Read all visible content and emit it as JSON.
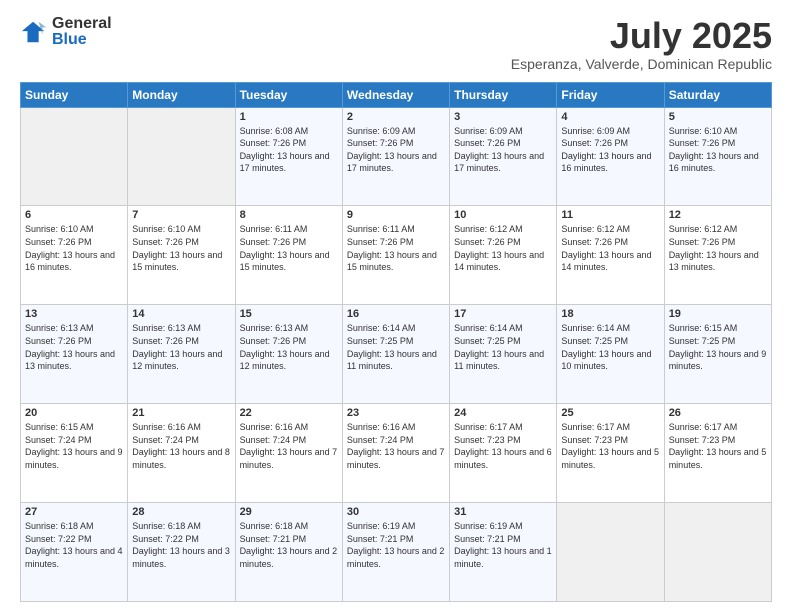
{
  "logo": {
    "general": "General",
    "blue": "Blue"
  },
  "title": "July 2025",
  "subtitle": "Esperanza, Valverde, Dominican Republic",
  "days_of_week": [
    "Sunday",
    "Monday",
    "Tuesday",
    "Wednesday",
    "Thursday",
    "Friday",
    "Saturday"
  ],
  "weeks": [
    [
      {
        "day": "",
        "empty": true
      },
      {
        "day": "",
        "empty": true
      },
      {
        "day": "1",
        "sunrise": "6:08 AM",
        "sunset": "7:26 PM",
        "daylight": "13 hours and 17 minutes."
      },
      {
        "day": "2",
        "sunrise": "6:09 AM",
        "sunset": "7:26 PM",
        "daylight": "13 hours and 17 minutes."
      },
      {
        "day": "3",
        "sunrise": "6:09 AM",
        "sunset": "7:26 PM",
        "daylight": "13 hours and 17 minutes."
      },
      {
        "day": "4",
        "sunrise": "6:09 AM",
        "sunset": "7:26 PM",
        "daylight": "13 hours and 16 minutes."
      },
      {
        "day": "5",
        "sunrise": "6:10 AM",
        "sunset": "7:26 PM",
        "daylight": "13 hours and 16 minutes."
      }
    ],
    [
      {
        "day": "6",
        "sunrise": "6:10 AM",
        "sunset": "7:26 PM",
        "daylight": "13 hours and 16 minutes."
      },
      {
        "day": "7",
        "sunrise": "6:10 AM",
        "sunset": "7:26 PM",
        "daylight": "13 hours and 15 minutes."
      },
      {
        "day": "8",
        "sunrise": "6:11 AM",
        "sunset": "7:26 PM",
        "daylight": "13 hours and 15 minutes."
      },
      {
        "day": "9",
        "sunrise": "6:11 AM",
        "sunset": "7:26 PM",
        "daylight": "13 hours and 15 minutes."
      },
      {
        "day": "10",
        "sunrise": "6:12 AM",
        "sunset": "7:26 PM",
        "daylight": "13 hours and 14 minutes."
      },
      {
        "day": "11",
        "sunrise": "6:12 AM",
        "sunset": "7:26 PM",
        "daylight": "13 hours and 14 minutes."
      },
      {
        "day": "12",
        "sunrise": "6:12 AM",
        "sunset": "7:26 PM",
        "daylight": "13 hours and 13 minutes."
      }
    ],
    [
      {
        "day": "13",
        "sunrise": "6:13 AM",
        "sunset": "7:26 PM",
        "daylight": "13 hours and 13 minutes."
      },
      {
        "day": "14",
        "sunrise": "6:13 AM",
        "sunset": "7:26 PM",
        "daylight": "13 hours and 12 minutes."
      },
      {
        "day": "15",
        "sunrise": "6:13 AM",
        "sunset": "7:26 PM",
        "daylight": "13 hours and 12 minutes."
      },
      {
        "day": "16",
        "sunrise": "6:14 AM",
        "sunset": "7:25 PM",
        "daylight": "13 hours and 11 minutes."
      },
      {
        "day": "17",
        "sunrise": "6:14 AM",
        "sunset": "7:25 PM",
        "daylight": "13 hours and 11 minutes."
      },
      {
        "day": "18",
        "sunrise": "6:14 AM",
        "sunset": "7:25 PM",
        "daylight": "13 hours and 10 minutes."
      },
      {
        "day": "19",
        "sunrise": "6:15 AM",
        "sunset": "7:25 PM",
        "daylight": "13 hours and 9 minutes."
      }
    ],
    [
      {
        "day": "20",
        "sunrise": "6:15 AM",
        "sunset": "7:24 PM",
        "daylight": "13 hours and 9 minutes."
      },
      {
        "day": "21",
        "sunrise": "6:16 AM",
        "sunset": "7:24 PM",
        "daylight": "13 hours and 8 minutes."
      },
      {
        "day": "22",
        "sunrise": "6:16 AM",
        "sunset": "7:24 PM",
        "daylight": "13 hours and 7 minutes."
      },
      {
        "day": "23",
        "sunrise": "6:16 AM",
        "sunset": "7:24 PM",
        "daylight": "13 hours and 7 minutes."
      },
      {
        "day": "24",
        "sunrise": "6:17 AM",
        "sunset": "7:23 PM",
        "daylight": "13 hours and 6 minutes."
      },
      {
        "day": "25",
        "sunrise": "6:17 AM",
        "sunset": "7:23 PM",
        "daylight": "13 hours and 5 minutes."
      },
      {
        "day": "26",
        "sunrise": "6:17 AM",
        "sunset": "7:23 PM",
        "daylight": "13 hours and 5 minutes."
      }
    ],
    [
      {
        "day": "27",
        "sunrise": "6:18 AM",
        "sunset": "7:22 PM",
        "daylight": "13 hours and 4 minutes."
      },
      {
        "day": "28",
        "sunrise": "6:18 AM",
        "sunset": "7:22 PM",
        "daylight": "13 hours and 3 minutes."
      },
      {
        "day": "29",
        "sunrise": "6:18 AM",
        "sunset": "7:21 PM",
        "daylight": "13 hours and 2 minutes."
      },
      {
        "day": "30",
        "sunrise": "6:19 AM",
        "sunset": "7:21 PM",
        "daylight": "13 hours and 2 minutes."
      },
      {
        "day": "31",
        "sunrise": "6:19 AM",
        "sunset": "7:21 PM",
        "daylight": "13 hours and 1 minute."
      },
      {
        "day": "",
        "empty": true
      },
      {
        "day": "",
        "empty": true
      }
    ]
  ]
}
